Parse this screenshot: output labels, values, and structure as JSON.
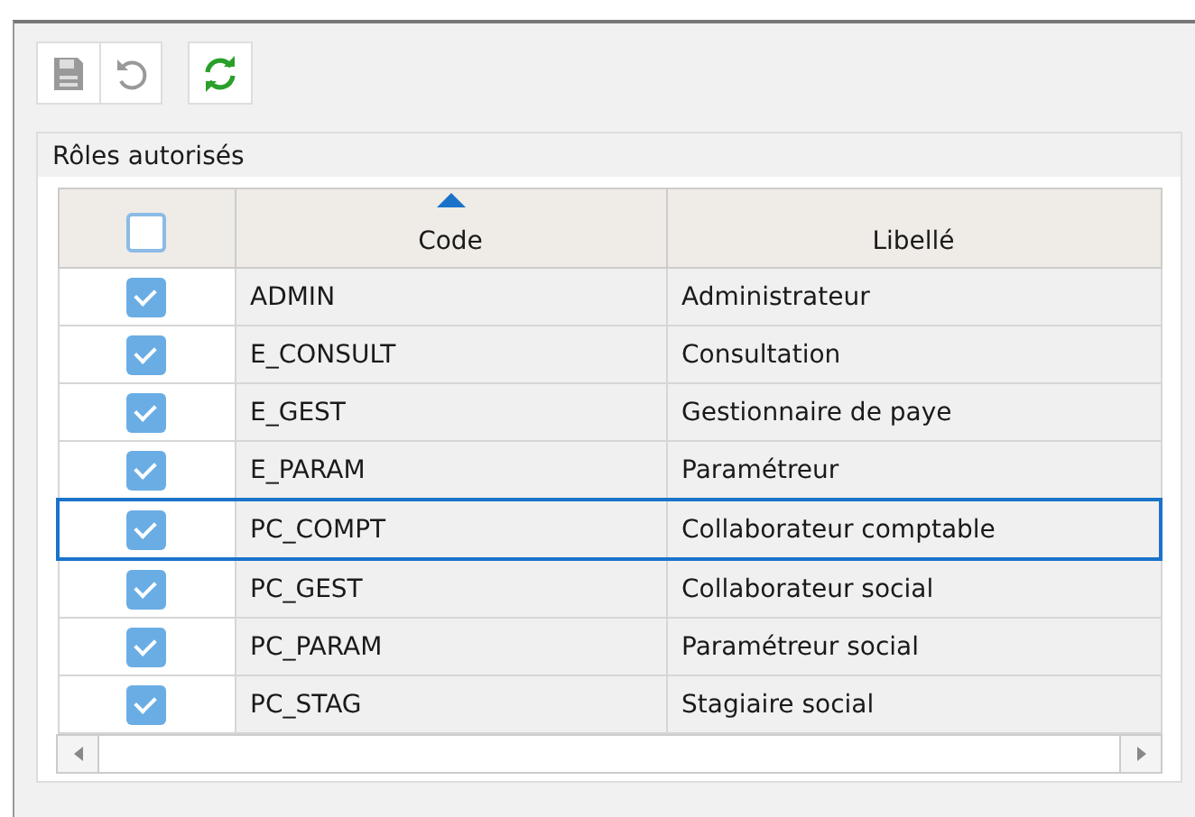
{
  "toolbar": {
    "buttons": [
      {
        "kind": "save",
        "disabled": true
      },
      {
        "kind": "undo",
        "disabled": true
      },
      {
        "kind": "refresh",
        "disabled": false
      }
    ]
  },
  "panel": {
    "title": "Rôles autorisés",
    "table": {
      "select_all": {
        "checked": false
      },
      "columns": [
        {
          "label": "Code",
          "sorted": true
        },
        {
          "label": "Libellé",
          "sorted": false
        }
      ],
      "rows": [
        {
          "checked": true,
          "selected": false,
          "code": "ADMIN",
          "label": "Administrateur"
        },
        {
          "checked": true,
          "selected": false,
          "code": "E_CONSULT",
          "label": "Consultation"
        },
        {
          "checked": true,
          "selected": false,
          "code": "E_GEST",
          "label": "Gestionnaire de paye"
        },
        {
          "checked": true,
          "selected": false,
          "code": "E_PARAM",
          "label": "Paramétreur"
        },
        {
          "checked": true,
          "selected": true,
          "code": "PC_COMPT",
          "label": "Collaborateur comptable"
        },
        {
          "checked": true,
          "selected": false,
          "code": "PC_GEST",
          "label": "Collaborateur social"
        },
        {
          "checked": true,
          "selected": false,
          "code": "PC_PARAM",
          "label": "Paramétreur social"
        },
        {
          "checked": true,
          "selected": false,
          "code": "PC_STAG",
          "label": "Stagiaire social"
        }
      ]
    }
  }
}
